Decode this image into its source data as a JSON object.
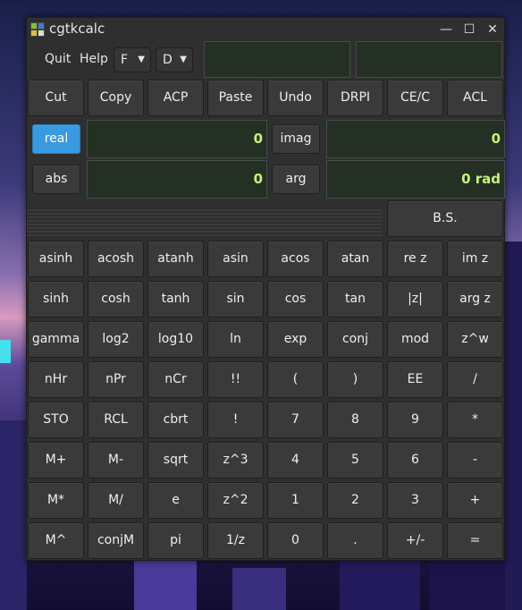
{
  "window": {
    "title": "cgtkcalc",
    "controls": {
      "minimize": "—",
      "maximize": "☐",
      "close": "✕"
    }
  },
  "menu": {
    "quit": "Quit",
    "help": "Help"
  },
  "combos": {
    "format": "F",
    "angle": "D"
  },
  "lcd": {
    "top_left": "",
    "top_right": "",
    "real_value": "0",
    "imag_value": "0",
    "abs_value": "0",
    "arg_value": "0 rad"
  },
  "toggles": {
    "real": "real",
    "imag": "imag",
    "abs": "abs",
    "arg": "arg"
  },
  "edit_row": [
    "Cut",
    "Copy",
    "ACP",
    "Paste",
    "Undo",
    "DRPI",
    "CE/C",
    "ACL"
  ],
  "backspace": "B.S.",
  "keypad": [
    [
      "asinh",
      "acosh",
      "atanh",
      "asin",
      "acos",
      "atan",
      "re z",
      "im z"
    ],
    [
      "sinh",
      "cosh",
      "tanh",
      "sin",
      "cos",
      "tan",
      "|z|",
      "arg z"
    ],
    [
      "gamma",
      "log2",
      "log10",
      "ln",
      "exp",
      "conj",
      "mod",
      "z^w"
    ],
    [
      "nHr",
      "nPr",
      "nCr",
      "!!",
      "(",
      ")",
      "EE",
      "/"
    ],
    [
      "STO",
      "RCL",
      "cbrt",
      "!",
      "7",
      "8",
      "9",
      "*"
    ],
    [
      "M+",
      "M-",
      "sqrt",
      "z^3",
      "4",
      "5",
      "6",
      "-"
    ],
    [
      "M*",
      "M/",
      "e",
      "z^2",
      "1",
      "2",
      "3",
      "+"
    ],
    [
      "M^",
      "conjM",
      "pi",
      "1/z",
      "0",
      ".",
      "+/-",
      "="
    ]
  ]
}
